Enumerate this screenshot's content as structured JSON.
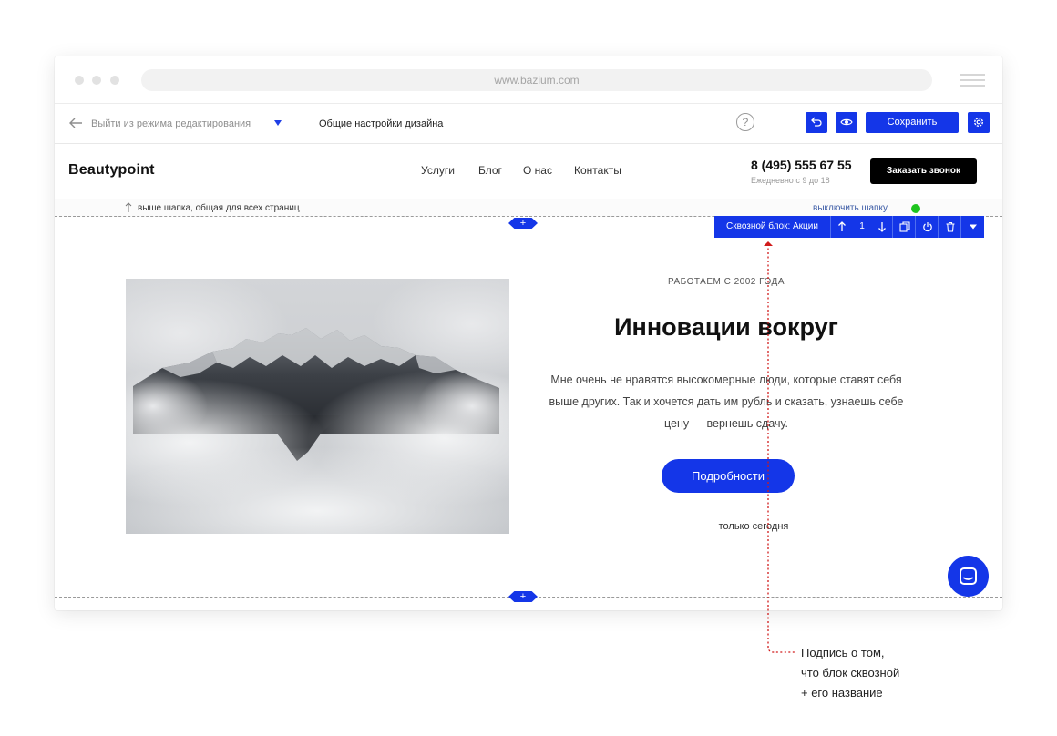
{
  "browser": {
    "url": "www.bazium.com"
  },
  "editor": {
    "exit_label": "Выйти из режима редактирования",
    "design_settings_label": "Общие настройки дизайна",
    "help_label": "?",
    "save_label": "Сохранить",
    "accent_color": "#1436e8"
  },
  "site_header": {
    "logo": "Beautypoint",
    "nav": [
      "Услуги",
      "Блог",
      "О нас",
      "Контакты"
    ],
    "phone": "8 (495) 555 67 55",
    "hours": "Ежедневно с 9 до 18",
    "call_button_label": "Заказать звонок"
  },
  "header_note": {
    "text": "выше шапка, общая для всех страниц",
    "disable_label": "выключить шапку",
    "status_color": "#1ec41e"
  },
  "block_toolbar": {
    "label": "Сквозной блок: Акции",
    "position": "1",
    "icons": [
      "arrow-up-icon",
      "arrow-down-icon",
      "copy-icon",
      "power-icon",
      "trash-icon",
      "caret-down-icon"
    ]
  },
  "add_block_label": "+",
  "hero": {
    "eyebrow": "РАБОТАЕМ С 2002 ГОДА",
    "title": "Инновации вокруг",
    "body": "Мне очень не нравятся высокомерные люди, которые ставят себя выше других. Так и хочется дать им рубль и сказать, узнаешь себе цену — вернешь сдачу.",
    "button_label": "Подробности",
    "footnote": "только сегодня"
  },
  "callout": {
    "lines": [
      "Подпись о том,",
      "что блок сквозной",
      "+ его название"
    ]
  }
}
